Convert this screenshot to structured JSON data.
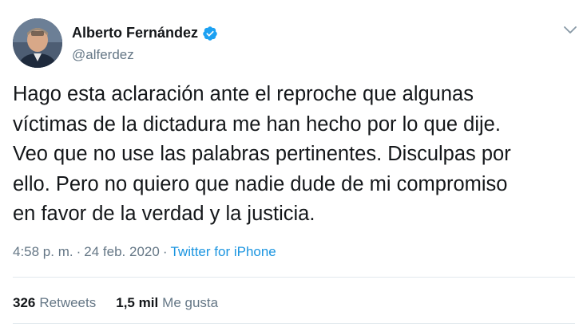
{
  "author": {
    "name": "Alberto Fernández",
    "handle": "@alferdez",
    "verified": true
  },
  "tweet": {
    "text": "Hago esta aclaración ante el reproche que algunas\nvíctimas de la dictadura me han hecho por lo que dije.\nVeo que no use las palabras pertinentes. Disculpas por\nello. Pero no quiero que nadie dude de mi compromiso\nen favor de la verdad y la justicia."
  },
  "meta": {
    "time": "4:58 p. m.",
    "separator": "·",
    "date": "24 feb. 2020",
    "source": "Twitter for iPhone"
  },
  "stats": {
    "retweets_count": "326",
    "retweets_label": "Retweets",
    "likes_count": "1,5 mil",
    "likes_label": "Me gusta"
  },
  "colors": {
    "link": "#1b95e0",
    "verified": "#1da1f2",
    "secondary_text": "#657786"
  }
}
